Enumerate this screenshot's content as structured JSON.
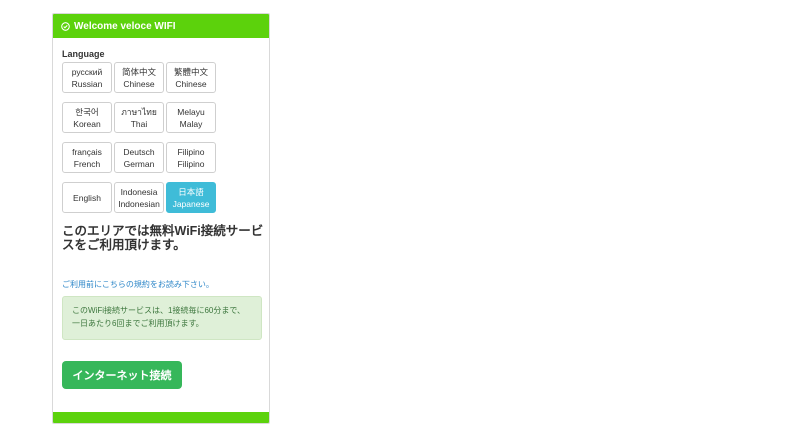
{
  "header": {
    "title": "Welcome veloce WIFI",
    "icon": "check-circle-icon",
    "color": "#5cd20c"
  },
  "language": {
    "label": "Language",
    "options": [
      {
        "native": "русский",
        "english": "Russian"
      },
      {
        "native": "简体中文",
        "english": "Chinese"
      },
      {
        "native": "繁體中文",
        "english": "Chinese"
      },
      {
        "native": "한국어",
        "english": "Korean"
      },
      {
        "native": "ภาษาไทย",
        "english": "Thai"
      },
      {
        "native": "Melayu",
        "english": "Malay"
      },
      {
        "native": "français",
        "english": "French"
      },
      {
        "native": "Deutsch",
        "english": "German"
      },
      {
        "native": "Filipino",
        "english": "Filipino"
      },
      {
        "native": "English",
        "english": ""
      },
      {
        "native": "Indonesia",
        "english": "Indonesian"
      },
      {
        "native": "日本語",
        "english": "Japanese"
      }
    ],
    "selected": "Japanese",
    "selected_color": "#3fbcd8"
  },
  "main": {
    "headline": "このエリアでは無料WiFi接続サービスをご利用頂けます。",
    "terms_link": "ご利用前にこちらの規約をお読み下さい。",
    "notice": "このWiFi接続サービスは、1接続毎に60分まで、一日あたり6回までご利用頂けます。",
    "connect_button": "インターネット接続",
    "connect_color": "#36b75a"
  }
}
